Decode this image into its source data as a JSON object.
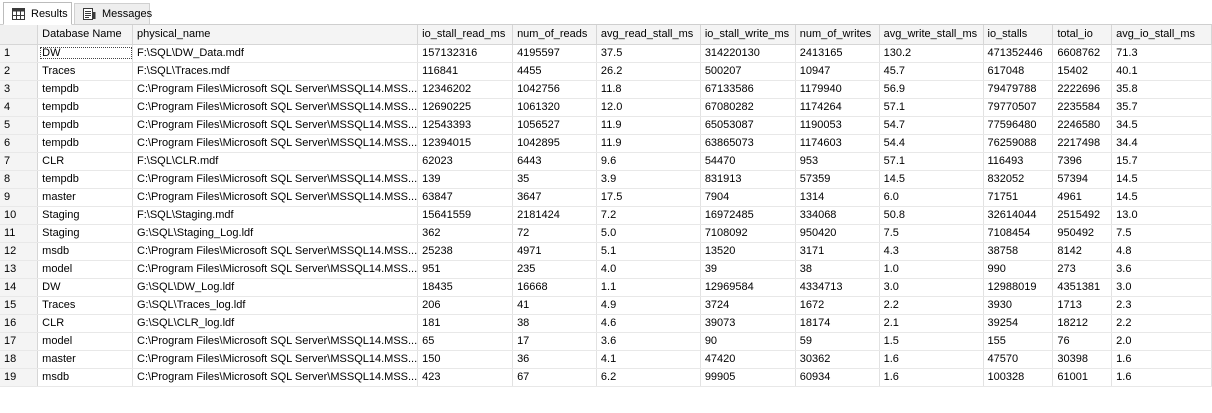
{
  "tabs": [
    {
      "label": "Results",
      "icon": "grid-icon"
    },
    {
      "label": "Messages",
      "icon": "messages-icon"
    }
  ],
  "columns": [
    "Database Name",
    "physical_name",
    "io_stall_read_ms",
    "num_of_reads",
    "avg_read_stall_ms",
    "io_stall_write_ms",
    "num_of_writes",
    "avg_write_stall_ms",
    "io_stalls",
    "total_io",
    "avg_io_stall_ms"
  ],
  "rows": [
    [
      "1",
      "DW",
      "F:\\SQL\\DW_Data.mdf",
      "157132316",
      "4195597",
      "37.5",
      "314220130",
      "2413165",
      "130.2",
      "471352446",
      "6608762",
      "71.3"
    ],
    [
      "2",
      "Traces",
      "F:\\SQL\\Traces.mdf",
      "116841",
      "4455",
      "26.2",
      "500207",
      "10947",
      "45.7",
      "617048",
      "15402",
      "40.1"
    ],
    [
      "3",
      "tempdb",
      "C:\\Program Files\\Microsoft SQL Server\\MSSQL14.MSS...",
      "12346202",
      "1042756",
      "11.8",
      "67133586",
      "1179940",
      "56.9",
      "79479788",
      "2222696",
      "35.8"
    ],
    [
      "4",
      "tempdb",
      "C:\\Program Files\\Microsoft SQL Server\\MSSQL14.MSS...",
      "12690225",
      "1061320",
      "12.0",
      "67080282",
      "1174264",
      "57.1",
      "79770507",
      "2235584",
      "35.7"
    ],
    [
      "5",
      "tempdb",
      "C:\\Program Files\\Microsoft SQL Server\\MSSQL14.MSS...",
      "12543393",
      "1056527",
      "11.9",
      "65053087",
      "1190053",
      "54.7",
      "77596480",
      "2246580",
      "34.5"
    ],
    [
      "6",
      "tempdb",
      "C:\\Program Files\\Microsoft SQL Server\\MSSQL14.MSS...",
      "12394015",
      "1042895",
      "11.9",
      "63865073",
      "1174603",
      "54.4",
      "76259088",
      "2217498",
      "34.4"
    ],
    [
      "7",
      "CLR",
      "F:\\SQL\\CLR.mdf",
      "62023",
      "6443",
      "9.6",
      "54470",
      "953",
      "57.1",
      "116493",
      "7396",
      "15.7"
    ],
    [
      "8",
      "tempdb",
      "C:\\Program Files\\Microsoft SQL Server\\MSSQL14.MSS...",
      "139",
      "35",
      "3.9",
      "831913",
      "57359",
      "14.5",
      "832052",
      "57394",
      "14.5"
    ],
    [
      "9",
      "master",
      "C:\\Program Files\\Microsoft SQL Server\\MSSQL14.MSS...",
      "63847",
      "3647",
      "17.5",
      "7904",
      "1314",
      "6.0",
      "71751",
      "4961",
      "14.5"
    ],
    [
      "10",
      "Staging",
      "F:\\SQL\\Staging.mdf",
      "15641559",
      "2181424",
      "7.2",
      "16972485",
      "334068",
      "50.8",
      "32614044",
      "2515492",
      "13.0"
    ],
    [
      "11",
      "Staging",
      "G:\\SQL\\Staging_Log.ldf",
      "362",
      "72",
      "5.0",
      "7108092",
      "950420",
      "7.5",
      "7108454",
      "950492",
      "7.5"
    ],
    [
      "12",
      "msdb",
      "C:\\Program Files\\Microsoft SQL Server\\MSSQL14.MSS...",
      "25238",
      "4971",
      "5.1",
      "13520",
      "3171",
      "4.3",
      "38758",
      "8142",
      "4.8"
    ],
    [
      "13",
      "model",
      "C:\\Program Files\\Microsoft SQL Server\\MSSQL14.MSS...",
      "951",
      "235",
      "4.0",
      "39",
      "38",
      "1.0",
      "990",
      "273",
      "3.6"
    ],
    [
      "14",
      "DW",
      "G:\\SQL\\DW_Log.ldf",
      "18435",
      "16668",
      "1.1",
      "12969584",
      "4334713",
      "3.0",
      "12988019",
      "4351381",
      "3.0"
    ],
    [
      "15",
      "Traces",
      "G:\\SQL\\Traces_log.ldf",
      "206",
      "41",
      "4.9",
      "3724",
      "1672",
      "2.2",
      "3930",
      "1713",
      "2.3"
    ],
    [
      "16",
      "CLR",
      "G:\\SQL\\CLR_log.ldf",
      "181",
      "38",
      "4.6",
      "39073",
      "18174",
      "2.1",
      "39254",
      "18212",
      "2.2"
    ],
    [
      "17",
      "model",
      "C:\\Program Files\\Microsoft SQL Server\\MSSQL14.MSS...",
      "65",
      "17",
      "3.6",
      "90",
      "59",
      "1.5",
      "155",
      "76",
      "2.0"
    ],
    [
      "18",
      "master",
      "C:\\Program Files\\Microsoft SQL Server\\MSSQL14.MSS...",
      "150",
      "36",
      "4.1",
      "47420",
      "30362",
      "1.6",
      "47570",
      "30398",
      "1.6"
    ],
    [
      "19",
      "msdb",
      "C:\\Program Files\\Microsoft SQL Server\\MSSQL14.MSS...",
      "423",
      "67",
      "6.2",
      "99905",
      "60934",
      "1.6",
      "100328",
      "61001",
      "1.6"
    ]
  ],
  "colors": {
    "header_bg": "#f4f4f4",
    "grid_line": "#e2e2e2",
    "tab_inactive_bg": "#eeeeee"
  }
}
